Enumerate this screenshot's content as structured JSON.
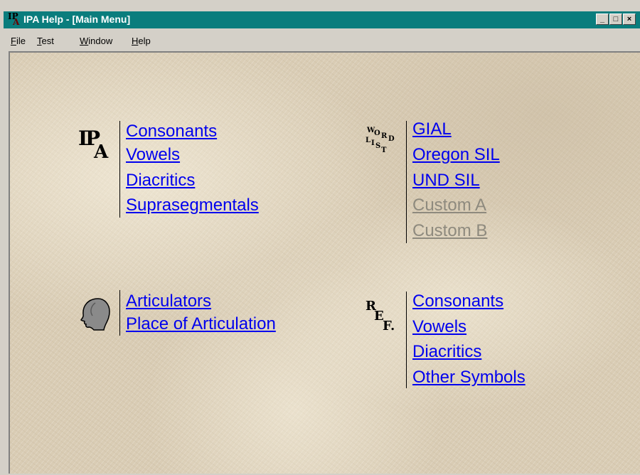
{
  "window": {
    "title": "IPA Help - [Main Menu]",
    "app_icon_glyphs": [
      "IP",
      "A"
    ],
    "controls": {
      "minimize": "_",
      "maximize": "□",
      "close": "×"
    }
  },
  "menubar": {
    "items": [
      {
        "label_u": "F",
        "label_rest": "ile"
      },
      {
        "label_u": "T",
        "label_rest": "est"
      },
      {
        "label_u": "W",
        "label_rest": "indow"
      },
      {
        "label_u": "H",
        "label_rest": "elp"
      }
    ]
  },
  "sections": {
    "ipa_chart": {
      "icon": "ipa-chart-icon",
      "links": [
        "Consonants",
        "Vowels",
        "Diacritics",
        "Suprasegmentals"
      ]
    },
    "word_lists": {
      "icon": "word-list-icon",
      "links": [
        "GIAL",
        "Oregon SIL",
        "UND SIL",
        "Custom A",
        "Custom B"
      ],
      "disabled": [
        "Custom A",
        "Custom B"
      ]
    },
    "articulation": {
      "icon": "head-profile-icon",
      "links": [
        "Articulators",
        "Place of Articulation"
      ]
    },
    "reference": {
      "icon": "reference-icon",
      "links": [
        "Consonants",
        "Vowels",
        "Diacritics",
        "Other Symbols"
      ]
    }
  },
  "colors": {
    "titlebar": "#0a7d7d",
    "link": "#0000ee",
    "link_disabled": "#8e8a7e",
    "background": "#d9ccb4"
  }
}
